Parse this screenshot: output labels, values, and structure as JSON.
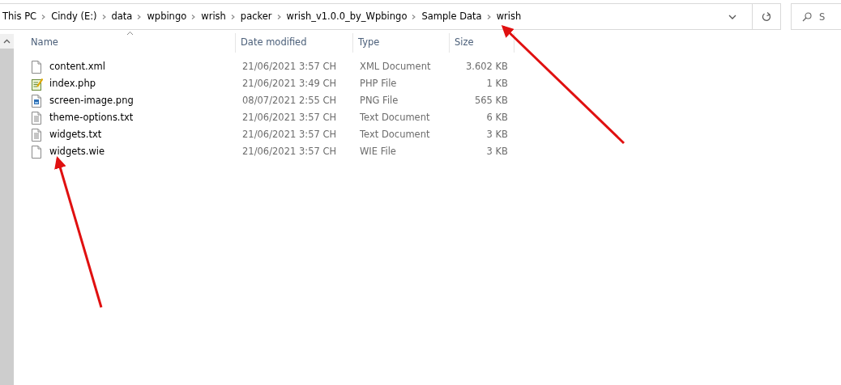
{
  "address_bar": {
    "crumbs": [
      "This PC",
      "Cindy (E:)",
      "data",
      "wpbingo",
      "wrish",
      "packer",
      "wrish_v1.0.0_by_Wpbingo",
      "Sample Data",
      "wrish"
    ]
  },
  "search": {
    "placeholder": "S"
  },
  "table": {
    "columns": [
      {
        "label": "Name",
        "sorted": true
      },
      {
        "label": "Date modified",
        "sorted": false
      },
      {
        "label": "Type",
        "sorted": false
      },
      {
        "label": "Size",
        "sorted": false
      }
    ],
    "rows": [
      {
        "kind": "blank",
        "name": "content.xml",
        "date": "21/06/2021 3:57 CH",
        "type": "XML Document",
        "size": "3.602 KB"
      },
      {
        "kind": "script",
        "name": "index.php",
        "date": "21/06/2021 3:49 CH",
        "type": "PHP File",
        "size": "1 KB"
      },
      {
        "kind": "image",
        "name": "screen-image.png",
        "date": "08/07/2021 2:55 CH",
        "type": "PNG File",
        "size": "565 KB"
      },
      {
        "kind": "text",
        "name": "theme-options.txt",
        "date": "21/06/2021 3:57 CH",
        "type": "Text Document",
        "size": "6 KB"
      },
      {
        "kind": "text",
        "name": "widgets.txt",
        "date": "21/06/2021 3:57 CH",
        "type": "Text Document",
        "size": "3 KB"
      },
      {
        "kind": "blank",
        "name": "widgets.wie",
        "date": "21/06/2021 3:57 CH",
        "type": "WIE File",
        "size": "3 KB"
      }
    ]
  },
  "annotations": [
    {
      "kind": "arrow"
    },
    {
      "kind": "arrow"
    }
  ]
}
